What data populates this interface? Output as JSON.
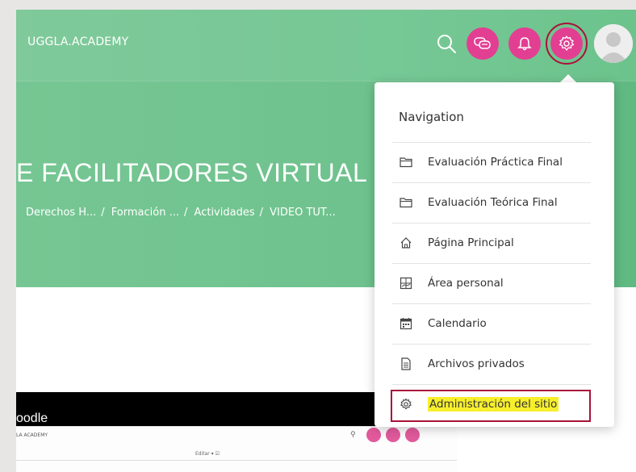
{
  "header": {
    "brand": "UGGLA.ACADEMY"
  },
  "course": {
    "title": "E FACILITADORES VIRTUAL",
    "breadcrumb": [
      "Derechos H...",
      "Formación ...",
      "Actividades",
      "VIDEO TUT..."
    ],
    "breadcrumb_separator": "/"
  },
  "video": {
    "label": "oodle",
    "mini_brand": "LA ACADEMY",
    "mini_edit": "Editar ▾ ☑"
  },
  "menu": {
    "heading": "Navigation",
    "items": [
      {
        "label": "Evaluación Práctica Final",
        "icon": "folder-icon"
      },
      {
        "label": "Evaluación Teórica Final",
        "icon": "folder-icon"
      },
      {
        "label": "Página Principal",
        "icon": "home-icon"
      },
      {
        "label": "Área personal",
        "icon": "dashboard-icon"
      },
      {
        "label": "Calendario",
        "icon": "calendar-icon"
      },
      {
        "label": "Archivos privados",
        "icon": "file-icon"
      },
      {
        "label": "Administración del sitio",
        "icon": "gear-icon",
        "highlighted": true
      }
    ]
  },
  "colors": {
    "header_green": "#76c895",
    "accent_pink": "#e23f93",
    "highlight_yellow": "#f7ef2c",
    "annotation_red": "#a8123a"
  }
}
